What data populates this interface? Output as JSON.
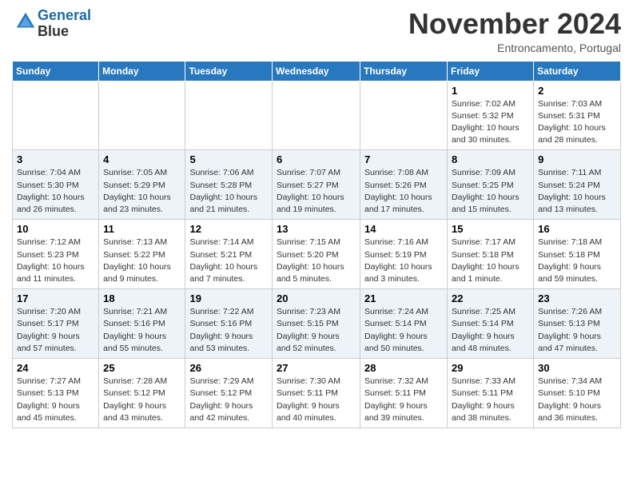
{
  "header": {
    "logo_line1": "General",
    "logo_line2": "Blue",
    "month_title": "November 2024",
    "location": "Entroncamento, Portugal"
  },
  "days_of_week": [
    "Sunday",
    "Monday",
    "Tuesday",
    "Wednesday",
    "Thursday",
    "Friday",
    "Saturday"
  ],
  "weeks": [
    [
      {
        "day": "",
        "info": ""
      },
      {
        "day": "",
        "info": ""
      },
      {
        "day": "",
        "info": ""
      },
      {
        "day": "",
        "info": ""
      },
      {
        "day": "",
        "info": ""
      },
      {
        "day": "1",
        "info": "Sunrise: 7:02 AM\nSunset: 5:32 PM\nDaylight: 10 hours\nand 30 minutes."
      },
      {
        "day": "2",
        "info": "Sunrise: 7:03 AM\nSunset: 5:31 PM\nDaylight: 10 hours\nand 28 minutes."
      }
    ],
    [
      {
        "day": "3",
        "info": "Sunrise: 7:04 AM\nSunset: 5:30 PM\nDaylight: 10 hours\nand 26 minutes."
      },
      {
        "day": "4",
        "info": "Sunrise: 7:05 AM\nSunset: 5:29 PM\nDaylight: 10 hours\nand 23 minutes."
      },
      {
        "day": "5",
        "info": "Sunrise: 7:06 AM\nSunset: 5:28 PM\nDaylight: 10 hours\nand 21 minutes."
      },
      {
        "day": "6",
        "info": "Sunrise: 7:07 AM\nSunset: 5:27 PM\nDaylight: 10 hours\nand 19 minutes."
      },
      {
        "day": "7",
        "info": "Sunrise: 7:08 AM\nSunset: 5:26 PM\nDaylight: 10 hours\nand 17 minutes."
      },
      {
        "day": "8",
        "info": "Sunrise: 7:09 AM\nSunset: 5:25 PM\nDaylight: 10 hours\nand 15 minutes."
      },
      {
        "day": "9",
        "info": "Sunrise: 7:11 AM\nSunset: 5:24 PM\nDaylight: 10 hours\nand 13 minutes."
      }
    ],
    [
      {
        "day": "10",
        "info": "Sunrise: 7:12 AM\nSunset: 5:23 PM\nDaylight: 10 hours\nand 11 minutes."
      },
      {
        "day": "11",
        "info": "Sunrise: 7:13 AM\nSunset: 5:22 PM\nDaylight: 10 hours\nand 9 minutes."
      },
      {
        "day": "12",
        "info": "Sunrise: 7:14 AM\nSunset: 5:21 PM\nDaylight: 10 hours\nand 7 minutes."
      },
      {
        "day": "13",
        "info": "Sunrise: 7:15 AM\nSunset: 5:20 PM\nDaylight: 10 hours\nand 5 minutes."
      },
      {
        "day": "14",
        "info": "Sunrise: 7:16 AM\nSunset: 5:19 PM\nDaylight: 10 hours\nand 3 minutes."
      },
      {
        "day": "15",
        "info": "Sunrise: 7:17 AM\nSunset: 5:18 PM\nDaylight: 10 hours\nand 1 minute."
      },
      {
        "day": "16",
        "info": "Sunrise: 7:18 AM\nSunset: 5:18 PM\nDaylight: 9 hours\nand 59 minutes."
      }
    ],
    [
      {
        "day": "17",
        "info": "Sunrise: 7:20 AM\nSunset: 5:17 PM\nDaylight: 9 hours\nand 57 minutes."
      },
      {
        "day": "18",
        "info": "Sunrise: 7:21 AM\nSunset: 5:16 PM\nDaylight: 9 hours\nand 55 minutes."
      },
      {
        "day": "19",
        "info": "Sunrise: 7:22 AM\nSunset: 5:16 PM\nDaylight: 9 hours\nand 53 minutes."
      },
      {
        "day": "20",
        "info": "Sunrise: 7:23 AM\nSunset: 5:15 PM\nDaylight: 9 hours\nand 52 minutes."
      },
      {
        "day": "21",
        "info": "Sunrise: 7:24 AM\nSunset: 5:14 PM\nDaylight: 9 hours\nand 50 minutes."
      },
      {
        "day": "22",
        "info": "Sunrise: 7:25 AM\nSunset: 5:14 PM\nDaylight: 9 hours\nand 48 minutes."
      },
      {
        "day": "23",
        "info": "Sunrise: 7:26 AM\nSunset: 5:13 PM\nDaylight: 9 hours\nand 47 minutes."
      }
    ],
    [
      {
        "day": "24",
        "info": "Sunrise: 7:27 AM\nSunset: 5:13 PM\nDaylight: 9 hours\nand 45 minutes."
      },
      {
        "day": "25",
        "info": "Sunrise: 7:28 AM\nSunset: 5:12 PM\nDaylight: 9 hours\nand 43 minutes."
      },
      {
        "day": "26",
        "info": "Sunrise: 7:29 AM\nSunset: 5:12 PM\nDaylight: 9 hours\nand 42 minutes."
      },
      {
        "day": "27",
        "info": "Sunrise: 7:30 AM\nSunset: 5:11 PM\nDaylight: 9 hours\nand 40 minutes."
      },
      {
        "day": "28",
        "info": "Sunrise: 7:32 AM\nSunset: 5:11 PM\nDaylight: 9 hours\nand 39 minutes."
      },
      {
        "day": "29",
        "info": "Sunrise: 7:33 AM\nSunset: 5:11 PM\nDaylight: 9 hours\nand 38 minutes."
      },
      {
        "day": "30",
        "info": "Sunrise: 7:34 AM\nSunset: 5:10 PM\nDaylight: 9 hours\nand 36 minutes."
      }
    ]
  ]
}
